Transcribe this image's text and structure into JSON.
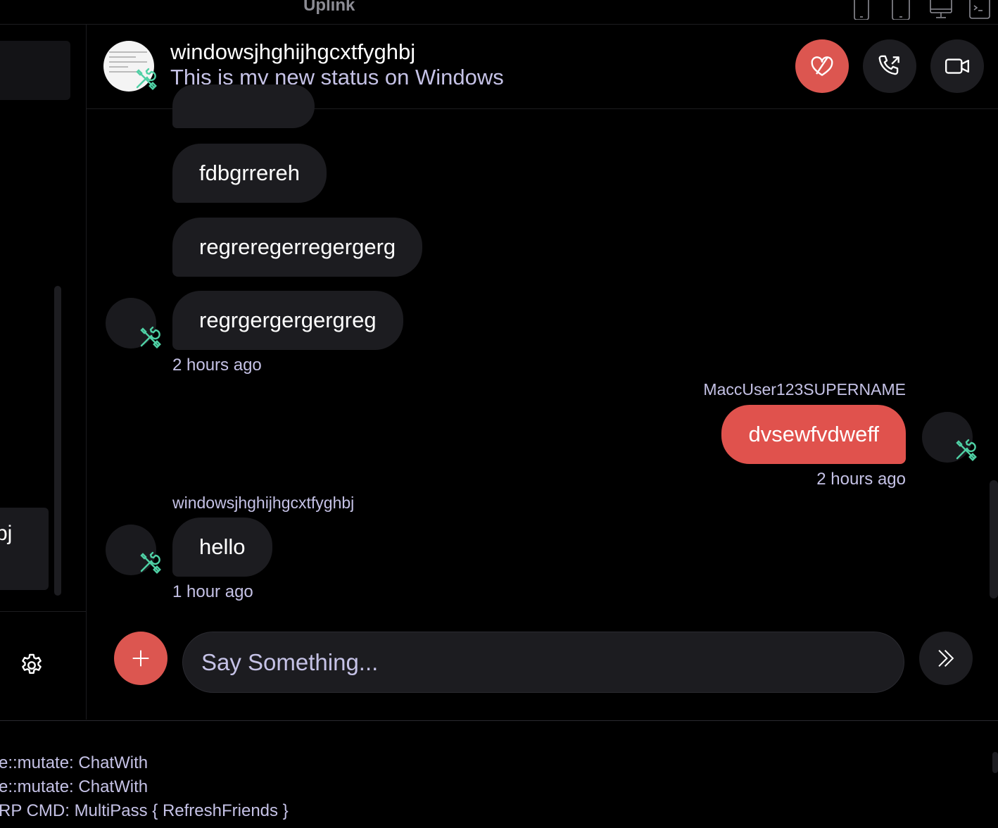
{
  "window": {
    "title": "Uplink"
  },
  "toolbar_icons": [
    "phone-portrait-icon",
    "tablet-icon",
    "desktop-icon",
    "terminal-icon"
  ],
  "sidebar": {
    "partial_item_text": "bj"
  },
  "chat_header": {
    "name": "windowsjhghijhgcxtfyghbj",
    "status": "This is my new status on Windows"
  },
  "messages": {
    "m1": "fdbgrrereh",
    "m2": "regreregerregergerg",
    "m3": "regrgergergergreg",
    "m3_time": "2 hours ago",
    "m4_sender": "MaccUser123SUPERNAME",
    "m4": "dvsewfvdweff",
    "m4_time": "2 hours ago",
    "m5_sender": "windowsjhghijhgcxtfyghbj",
    "m5": "hello",
    "m5_time": "1 hour ago"
  },
  "composer": {
    "placeholder": "Say Something..."
  },
  "log": [
    "e::mutate: ChatWith",
    "e::mutate: ChatWith",
    "RP CMD: MultiPass { RefreshFriends }"
  ],
  "colors": {
    "accent": "#dc5650",
    "badge": "#4fd1a5",
    "muted_text": "#c5c2e6",
    "bubble": "#1c1c20"
  }
}
